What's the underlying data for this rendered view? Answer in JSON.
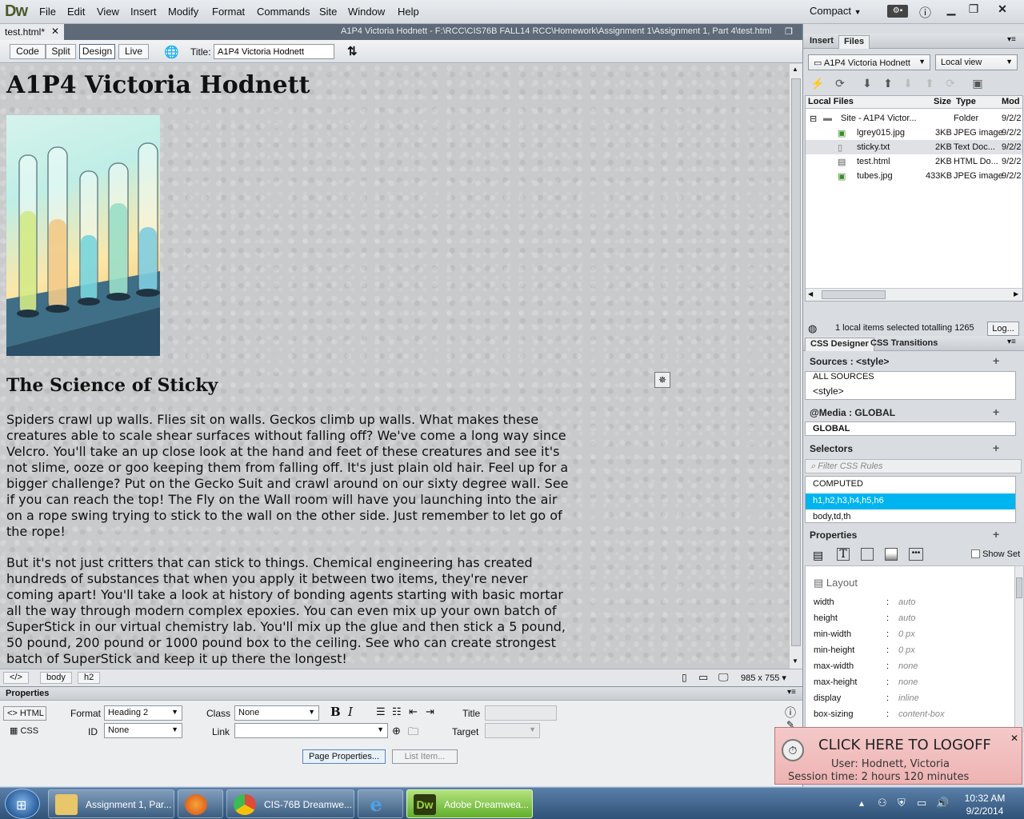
{
  "app": {
    "logo": "Dw",
    "menu": [
      "File",
      "Edit",
      "View",
      "Insert",
      "Modify",
      "Format",
      "Commands",
      "Site",
      "Window",
      "Help"
    ],
    "workspace": "Compact"
  },
  "document": {
    "tab": "test.html*",
    "path": "A1P4 Victoria Hodnett - F:\\RCC\\CIS76B FALL14 RCC\\Homework\\Assignment 1\\Assignment 1, Part 4\\test.html",
    "views": [
      "Code",
      "Split",
      "Design",
      "Live"
    ],
    "active_view": "Design",
    "title_label": "Title:",
    "title_value": "A1P4 Victoria Hodnett"
  },
  "page": {
    "h1": "A1P4 Victoria Hodnett",
    "h2": "The Science of Sticky",
    "para1": "Spiders crawl up walls. Flies sit on walls. Geckos climb up walls. What makes these creatures able to scale shear surfaces without falling off? We've come a long way since Velcro. You'll take an up close look at the hand and feet of these creatures and see it's not slime, ooze or goo keeping them from falling off. It's just plain old hair. Feel up for a bigger challenge? Put on the Gecko Suit and crawl around on our sixty degree wall. See if you can reach the top! The Fly on the Wall room will have you launching into the air on a rope swing trying to stick to the wall on the other side. Just remember to let go of the rope!",
    "para2": "But it's not just critters that can stick to things. Chemical engineering has created hundreds of substances that when you apply it between two items, they're never coming apart! You'll take a look at history of bonding agents starting with basic mortar all the way through modern complex epoxies. You can even mix up your own batch of SuperStick in our virtual chemistry lab. You'll mix up the glue and then stick a 5 pound, 50 pound, 200 pound or 1000 pound box to the ceiling. See who can create strongest batch of SuperStick and keep it up there the longest!"
  },
  "status": {
    "code_tag": "</>",
    "tags": [
      "body",
      "h2"
    ],
    "window_size": "985 x 755"
  },
  "properties": {
    "header": "Properties",
    "html_btn": "<> HTML",
    "css_btn": "CSS",
    "format_label": "Format",
    "format_value": "Heading 2",
    "class_label": "Class",
    "class_value": "None",
    "id_label": "ID",
    "id_value": "None",
    "link_label": "Link",
    "title_label": "Title",
    "target_label": "Target",
    "page_props_btn": "Page Properties...",
    "list_item_btn": "List Item..."
  },
  "files_panel": {
    "tabs": [
      "Insert",
      "Files"
    ],
    "site": "A1P4 Victoria Hodnett",
    "view": "Local view",
    "columns": [
      "Local Files",
      "Size",
      "Type",
      "Mod"
    ],
    "rows": [
      {
        "name": "Site - A1P4 Victor...",
        "size": "",
        "type": "Folder",
        "mod": "9/2/2"
      },
      {
        "name": "lgrey015.jpg",
        "size": "3KB",
        "type": "JPEG image",
        "mod": "9/2/2"
      },
      {
        "name": "sticky.txt",
        "size": "2KB",
        "type": "Text Doc...",
        "mod": "9/2/2"
      },
      {
        "name": "test.html",
        "size": "2KB",
        "type": "HTML Do...",
        "mod": "9/2/2"
      },
      {
        "name": "tubes.jpg",
        "size": "433KB",
        "type": "JPEG image",
        "mod": "9/2/2"
      }
    ],
    "status": "1 local items selected totalling 1265",
    "log_btn": "Log..."
  },
  "css_panel": {
    "tabs": [
      "CSS Designer",
      "CSS Transitions"
    ],
    "sources_label": "Sources : <style>",
    "sources": [
      "ALL SOURCES",
      "<style>"
    ],
    "media_label": "@Media : GLOBAL",
    "media": "GLOBAL",
    "selectors_label": "Selectors",
    "filter_placeholder": "Filter CSS Rules",
    "selectors": [
      "COMPUTED",
      "h1,h2,h3,h4,h5,h6",
      "body,td,th"
    ],
    "properties_label": "Properties",
    "show_set": "Show Set",
    "layout_label": "Layout",
    "props": [
      {
        "k": "width",
        "v": "auto"
      },
      {
        "k": "height",
        "v": "auto"
      },
      {
        "k": "min-width",
        "v": "0 px"
      },
      {
        "k": "min-height",
        "v": "0 px"
      },
      {
        "k": "max-width",
        "v": "none"
      },
      {
        "k": "max-height",
        "v": "none"
      },
      {
        "k": "display",
        "v": "inline"
      },
      {
        "k": "box-sizing",
        "v": "content-box"
      }
    ]
  },
  "logoff": {
    "title": "CLICK HERE TO LOGOFF",
    "user": "User:  Hodnett, Victoria",
    "session": "Session time:  2 hours   120 minutes"
  },
  "taskbar": {
    "items": [
      "Assignment 1, Par...",
      "CIS-76B Dreamwe...",
      "Adobe Dreamwea..."
    ],
    "time": "10:32 AM",
    "date": "9/2/2014"
  },
  "colors": {
    "selected_row": "#00b4f0",
    "dw_green": "#4a5a2a"
  }
}
